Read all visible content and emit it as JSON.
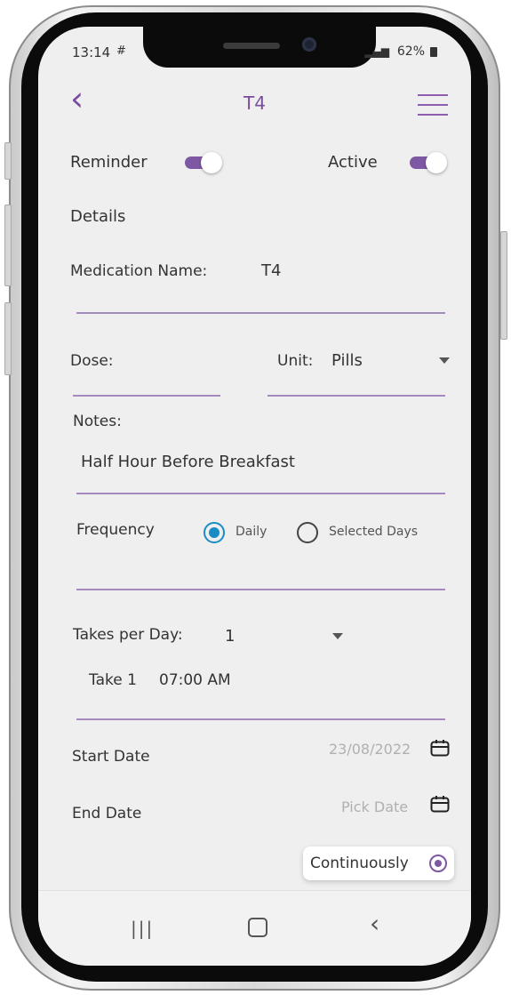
{
  "status": {
    "time": "13:14",
    "battery": "62%"
  },
  "header": {
    "title": "T4"
  },
  "toggles": {
    "reminder_label": "Reminder",
    "active_label": "Active",
    "reminder_on": true,
    "active_on": true
  },
  "details": {
    "heading": "Details"
  },
  "medication": {
    "label": "Medication Name:",
    "value": "T4"
  },
  "dose": {
    "label": "Dose:",
    "value": ""
  },
  "unit": {
    "label": "Unit:",
    "value": "Pills"
  },
  "notes": {
    "label": "Notes:",
    "value": "Half Hour Before Breakfast"
  },
  "frequency": {
    "label": "Frequency",
    "options": [
      "Daily",
      "Selected Days"
    ],
    "selected": "Daily"
  },
  "takes": {
    "label": "Takes per Day:",
    "value": "1",
    "take_label": "Take 1",
    "take_time": "07:00 AM"
  },
  "dates": {
    "start_label": "Start Date",
    "start_value": "23/08/2022",
    "end_label": "End Date",
    "end_placeholder": "Pick Date"
  },
  "continuously": {
    "label": "Continuously",
    "selected": true
  },
  "colors": {
    "accent": "#7e58a2",
    "radio_blue": "#1a8cc4",
    "line": "#a58ac0"
  },
  "icons": [
    "back-chevron-icon",
    "hamburger-menu-icon",
    "calendar-icon",
    "dropdown-caret-icon"
  ]
}
